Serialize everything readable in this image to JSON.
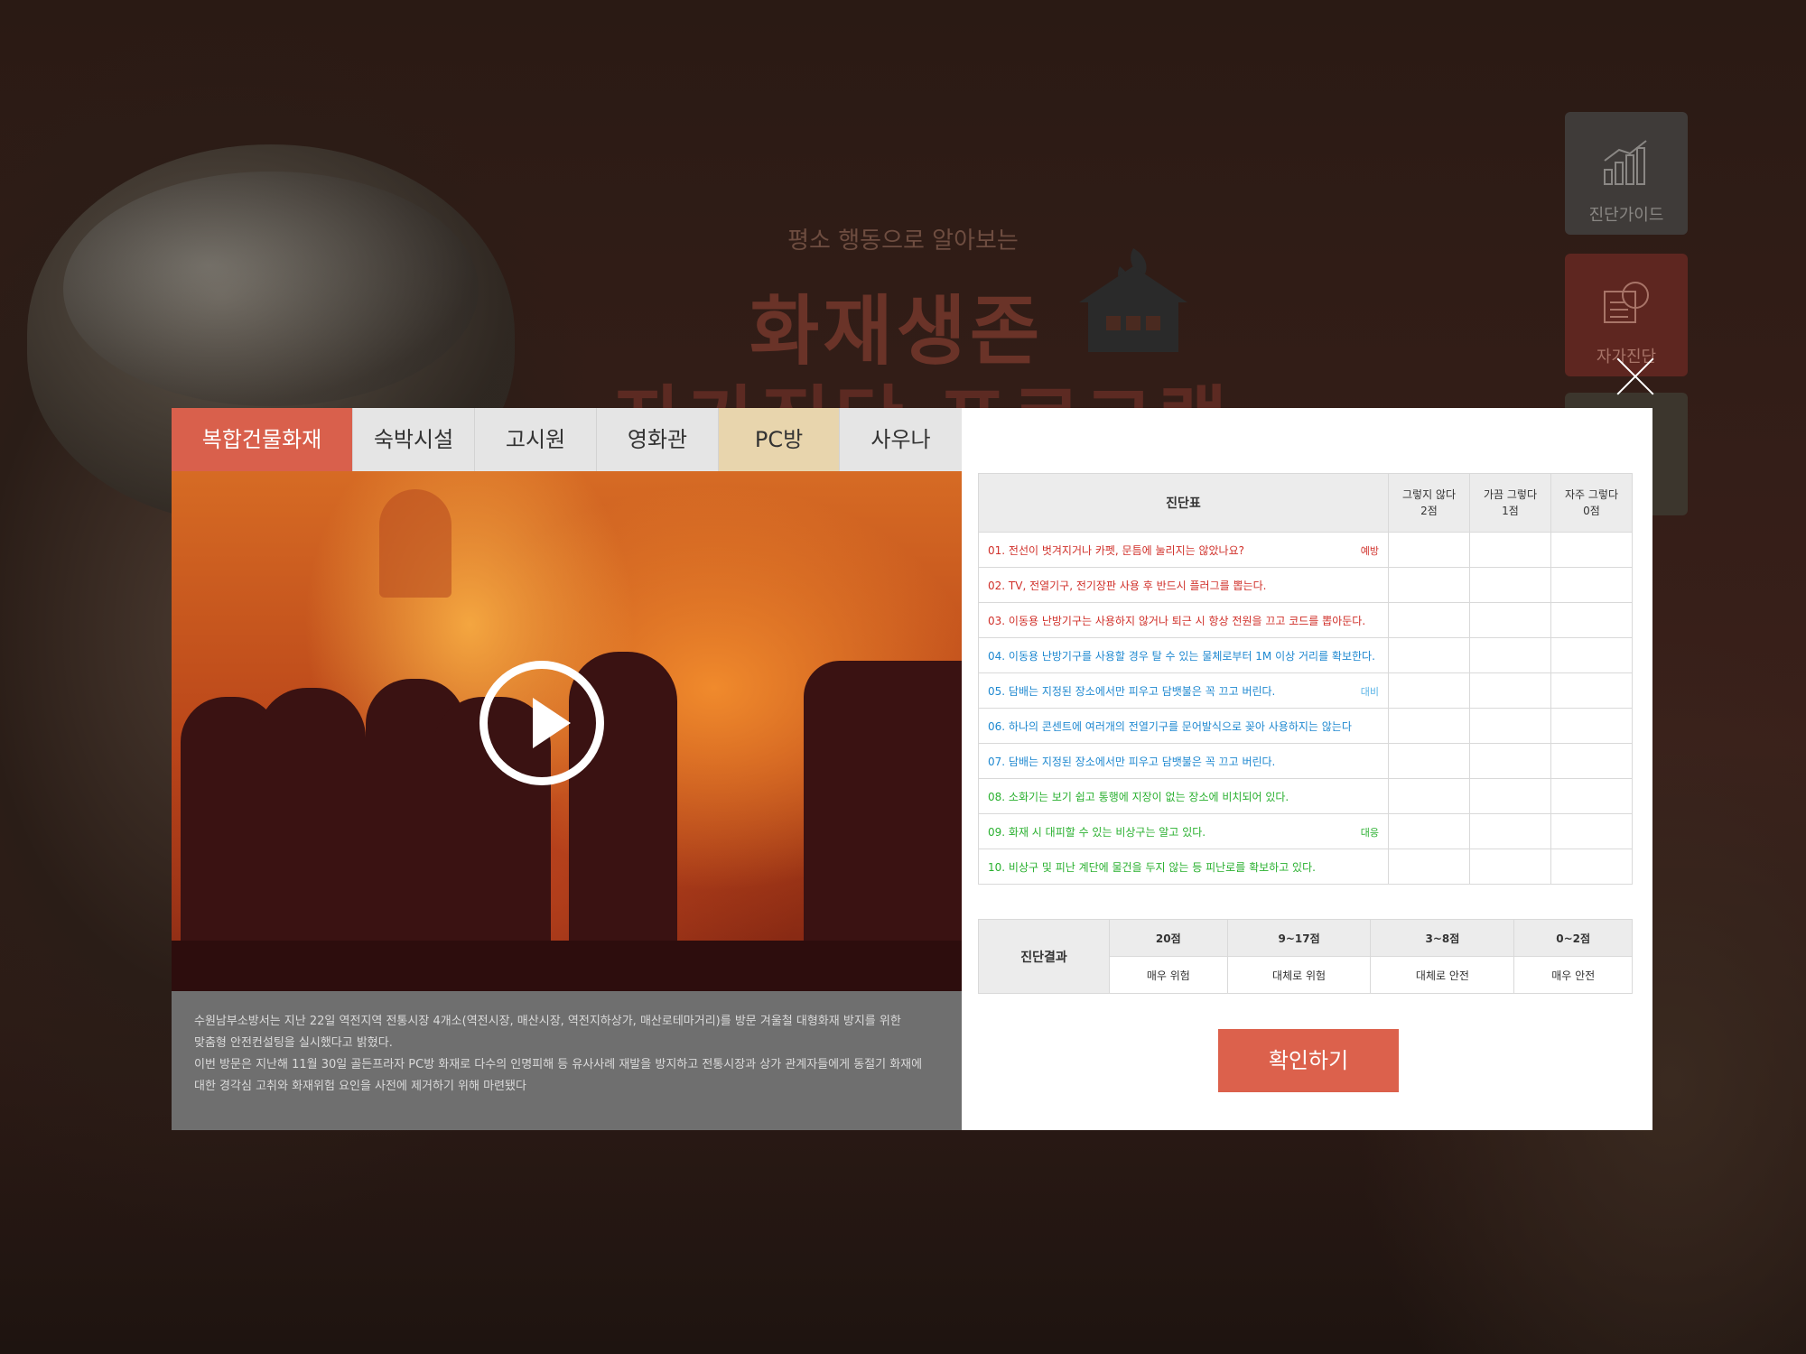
{
  "background": {
    "subtitle": "평소 행동으로 알아보는",
    "title_line1": "화재생존",
    "title_line2": "자가진단 프로그램"
  },
  "side_menu": {
    "guide_label": "진단가이드",
    "self_label": "자가진단"
  },
  "tabs": [
    {
      "label": "복합건물화재",
      "state": "active"
    },
    {
      "label": "숙박시설"
    },
    {
      "label": "고시원"
    },
    {
      "label": "영화관"
    },
    {
      "label": "PC방",
      "state": "highlight"
    },
    {
      "label": "사우나"
    }
  ],
  "video": {
    "description": [
      "수원남부소방서는 지난 22일 역전지역 전통시장 4개소(역전시장, 매산시장, 역전지하상가, 매산로테마거리)를 방문 겨울철 대형화재 방지를 위한",
      "맞춤형 안전컨설팅을 실시했다고 밝혔다.",
      "이번 방문은 지난해 11월 30일 골든프라자 PC방 화재로 다수의 인명피해 등 유사사례 재발을 방지하고 전통시장과 상가 관계자들에게 동절기 화재에",
      "대한 경각심 고취와 화재위험 요인을 사전에 제거하기 위해 마련됐다"
    ]
  },
  "diagnosis": {
    "header": "진단표",
    "options": [
      {
        "line1": "그렇지 않다",
        "line2": "2점"
      },
      {
        "line1": "가끔 그렇다",
        "line2": "1점"
      },
      {
        "line1": "자주 그렇다",
        "line2": "0점"
      }
    ],
    "questions": [
      {
        "text": "01. 전선이 벗겨지거나 카펫, 문틈에 눌리지는 않았나요?",
        "tag": "예방",
        "color": "#d0302a"
      },
      {
        "text": "02. TV, 전열기구, 전기장판 사용 후 반드시 플러그를 뽑는다.",
        "tag": "",
        "color": "#d0302a"
      },
      {
        "text": "03. 이동용 난방기구는 사용하지 않거나 퇴근 시 항상 전원을 끄고 코드를 뽑아둔다.",
        "tag": "",
        "color": "#d0302a"
      },
      {
        "text": "04. 이동용 난방기구를 사용할 경우 탈 수 있는 물체로부터 1M 이상 거리를 확보한다.",
        "tag": "",
        "color": "#1e88d0"
      },
      {
        "text": "05. 담배는 지정된 장소에서만 피우고 담뱃불은 꼭 끄고 버린다.",
        "tag": "대비",
        "color": "#1e88d0"
      },
      {
        "text": "06. 하나의 콘센트에 여러개의 전열기구를 문어발식으로 꽂아 사용하지는 않는다",
        "tag": "",
        "color": "#1e88d0"
      },
      {
        "text": "07. 담배는 지정된 장소에서만 피우고 담뱃불은 꼭 끄고 버린다.",
        "tag": "",
        "color": "#1e88d0"
      },
      {
        "text": "08. 소화기는 보기 쉽고 통행에 지장이 없는 장소에 비치되어 있다.",
        "tag": "",
        "color": "#29b02f"
      },
      {
        "text": "09. 화재 시 대피할 수 있는 비상구는 알고 있다.",
        "tag": "대응",
        "color": "#29b02f"
      },
      {
        "text": "10. 비상구 및 피난 계단에 물건을 두지 않는 등 피난로를 확보하고 있다.",
        "tag": "",
        "color": "#29b02f"
      }
    ]
  },
  "result": {
    "label": "진단결과",
    "scores": [
      "20점",
      "9~17점",
      "3~8점",
      "0~2점"
    ],
    "verdicts": [
      "매우 위험",
      "대체로 위험",
      "대체로 안전",
      "매우 안전"
    ]
  },
  "confirm_label": "확인하기",
  "colors": {
    "accent": "#dc614c",
    "prevent": "#d0302a",
    "prepare": "#1e88d0",
    "respond": "#29b02f"
  }
}
